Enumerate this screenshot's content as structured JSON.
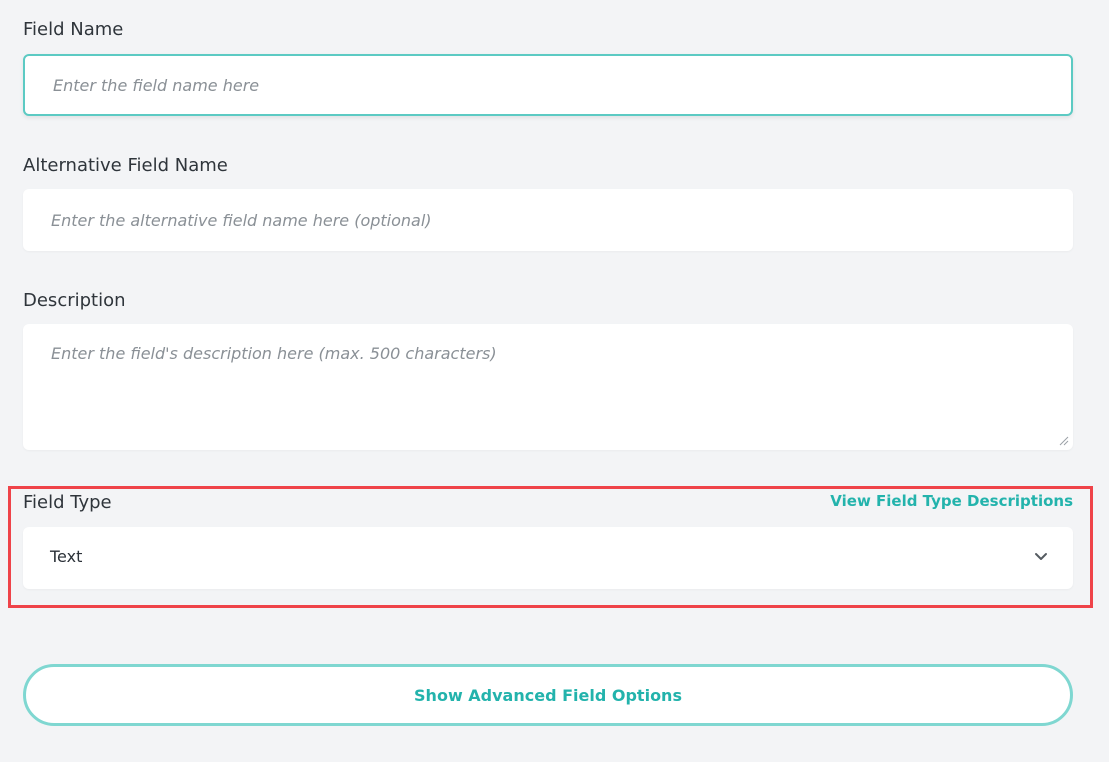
{
  "form": {
    "field_name": {
      "label": "Field Name",
      "placeholder": "Enter the field name here"
    },
    "alternative_field_name": {
      "label": "Alternative Field Name",
      "placeholder": "Enter the alternative field name here (optional)"
    },
    "description": {
      "label": "Description",
      "placeholder": "Enter the field's description here (max. 500 characters)"
    },
    "field_type": {
      "label": "Field Type",
      "link_label": "View Field Type Descriptions",
      "selected_value": "Text",
      "icon": "chevron-down-icon"
    },
    "advanced_button_label": "Show Advanced Field Options"
  },
  "colors": {
    "accent": "#23b3ac",
    "focus_border": "#5ccac3",
    "highlight": "#ef4349",
    "background": "#f3f4f6"
  }
}
